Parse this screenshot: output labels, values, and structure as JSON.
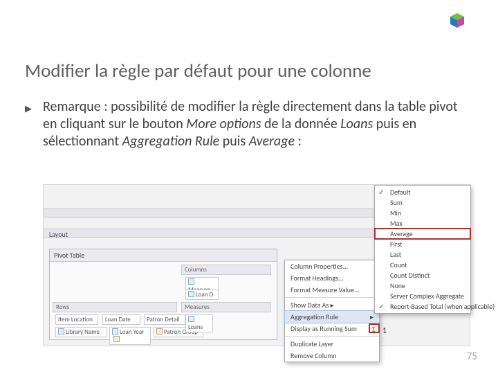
{
  "logo_name": "cube-logo",
  "title": "Modifier la règle par défaut pour une colonne",
  "body": {
    "p1a": "Remarque : possibilité de modifier la règle directement dans la table pivot en cliquant sur le bouton ",
    "more_options": "More options",
    "p1b": " de la donnée ",
    "loans": "Loans",
    "p1c": " puis en sélectionnant ",
    "agg_rule": "Aggregation Rule",
    "p1d": " puis ",
    "average": "Average",
    "p1e": " :"
  },
  "page_number": "75",
  "shot": {
    "layout_label": "Layout",
    "pivot_header": "Pivot Table",
    "sections": {
      "columns": "Columns",
      "rows": "Rows",
      "measures": "Measures",
      "measure_lbl": "Measure"
    },
    "fields": {
      "item_location": "Item Location",
      "library_name": "Library Name",
      "loan_date": "Loan Date",
      "loan_year": "Loan Year",
      "patron_detail": "Patron Detail",
      "patron_group": "Patron Group",
      "loan_d": "Loan D",
      "loans": "Loans"
    },
    "context_menu": {
      "column_props": "Column Properties...",
      "format_headings": "Format Headings...",
      "format_values": "Format Measure Value...",
      "show_data_as": "Show Data As",
      "aggregation_rule": "Aggregation Rule",
      "running_sum": "Display as Running Sum",
      "duplicate": "Duplicate Layer",
      "remove": "Remove Column"
    },
    "submenu": {
      "default": "Default",
      "sum": "Sum",
      "min": "Min",
      "max": "Max",
      "average": "Average",
      "first": "First",
      "last": "Last",
      "count": "Count",
      "count_distinct": "Count Distinct",
      "none": "None",
      "server_complex": "Server Complex Aggregate",
      "report_based": "Report-Based Total (when applicable)"
    },
    "annotation": "1"
  }
}
